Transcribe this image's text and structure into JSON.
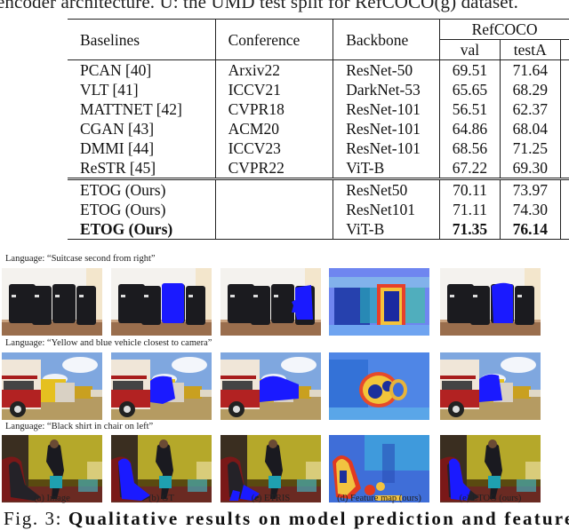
{
  "header_text": "encoder architecture. U: the UMD test split for RefCOCO(g) dataset.",
  "table": {
    "columns": [
      "Baselines",
      "Conference",
      "Backbone"
    ],
    "group_header": "RefCOCO",
    "sub_columns": [
      "val",
      "testA"
    ],
    "rows": [
      {
        "baseline": "PCAN [40]",
        "conference": "Arxiv22",
        "backbone": "ResNet-50",
        "val": "69.51",
        "testA": "71.64",
        "bold": false
      },
      {
        "baseline": "VLT [41]",
        "conference": "ICCV21",
        "backbone": "DarkNet-53",
        "val": "65.65",
        "testA": "68.29",
        "bold": false
      },
      {
        "baseline": "MATTNET [42]",
        "conference": "CVPR18",
        "backbone": "ResNet-101",
        "val": "56.51",
        "testA": "62.37",
        "bold": false
      },
      {
        "baseline": "CGAN [43]",
        "conference": "ACM20",
        "backbone": "ResNet-101",
        "val": "64.86",
        "testA": "68.04",
        "bold": false
      },
      {
        "baseline": "DMMI [44]",
        "conference": "ICCV23",
        "backbone": "ResNet-101",
        "val": "68.56",
        "testA": "71.25",
        "bold": false
      },
      {
        "baseline": "ReSTR [45]",
        "conference": "CVPR22",
        "backbone": "ViT-B",
        "val": "67.22",
        "testA": "69.30",
        "bold": false
      },
      {
        "baseline": "ETOG (Ours)",
        "conference": "",
        "backbone": "ResNet50",
        "val": "70.11",
        "testA": "73.97",
        "bold": false
      },
      {
        "baseline": "ETOG (Ours)",
        "conference": "",
        "backbone": "ResNet101",
        "val": "71.11",
        "testA": "74.30",
        "bold": false
      },
      {
        "baseline": "ETOG (Ours)",
        "conference": "",
        "backbone": "ViT-B",
        "val": "71.35",
        "testA": "76.14",
        "bold": true
      }
    ]
  },
  "figure": {
    "rows": [
      {
        "language": "Language: “Suitcase second from right”",
        "scene": "suitcase"
      },
      {
        "language": "Language: “Yellow and blue vehicle closest to camera”",
        "scene": "bus"
      },
      {
        "language": "Language: “Black shirt in chair on left”",
        "scene": "room"
      }
    ],
    "column_labels": [
      "(a) Image",
      "(b) GT",
      "(c) ETRIS",
      "(d) Feature map (ours)",
      "(e) ETOG (ours)"
    ],
    "column_kinds": [
      "image",
      "gt",
      "etris",
      "feature-map",
      "etog"
    ],
    "mask_color": "#1a1aff"
  },
  "caption": {
    "prefix": "Fig. 3:",
    "bold_text": "Qualitative results on model prediction and feature"
  }
}
